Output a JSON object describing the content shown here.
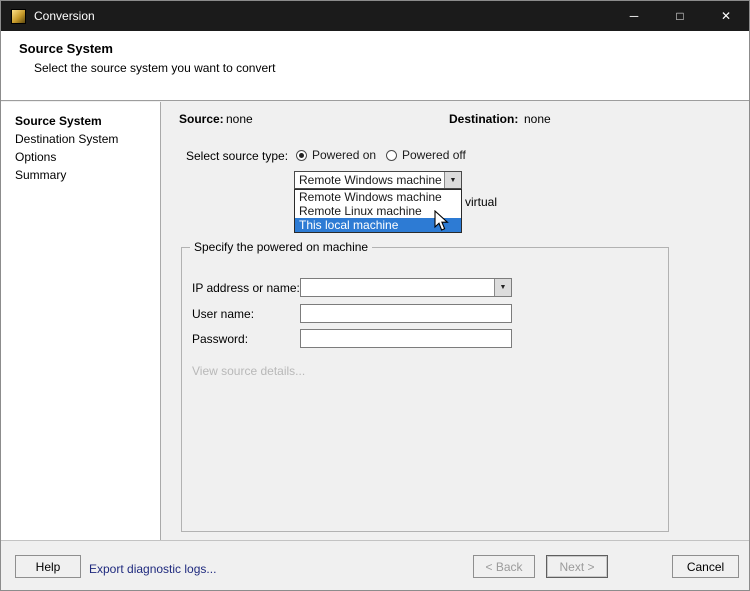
{
  "window": {
    "title": "Conversion",
    "minimize": "─",
    "maximize": "□",
    "close": "✕"
  },
  "header": {
    "title": "Source System",
    "subtitle": "Select the source system you want to convert"
  },
  "sidebar": {
    "items": [
      {
        "label": "Source System",
        "active": true
      },
      {
        "label": "Destination System",
        "active": false
      },
      {
        "label": "Options",
        "active": false
      },
      {
        "label": "Summary",
        "active": false
      }
    ]
  },
  "status": {
    "source_label": "Source:",
    "source_value": "none",
    "destination_label": "Destination:",
    "destination_value": "none"
  },
  "source_type": {
    "label": "Select source type:",
    "powered_on": "Powered on",
    "powered_on_selected": true,
    "powered_off": "Powered off",
    "powered_off_selected": false,
    "selected_option": "Remote Windows machine",
    "options": [
      {
        "label": "Remote Windows machine",
        "highlighted": false
      },
      {
        "label": "Remote Linux machine",
        "highlighted": false
      },
      {
        "label": "This local machine",
        "highlighted": true
      }
    ],
    "clipped_text": "virtual"
  },
  "machine_group": {
    "title": "Specify the powered on machine",
    "ip_label": "IP address or name:",
    "ip_value": "",
    "user_label": "User name:",
    "user_value": "",
    "password_label": "Password:",
    "password_value": "",
    "details_link": "View source details..."
  },
  "footer": {
    "help": "Help",
    "export_logs": "Export diagnostic logs...",
    "back": "< Back",
    "next": "Next >",
    "cancel": "Cancel"
  },
  "icons": {
    "dropdown_arrow": "▼"
  },
  "colors": {
    "titlebar": "#1b1b1b",
    "selection_blue": "#2d7bd4",
    "link_blue": "#1f2a7e",
    "content_bg": "#f0f0f0"
  }
}
